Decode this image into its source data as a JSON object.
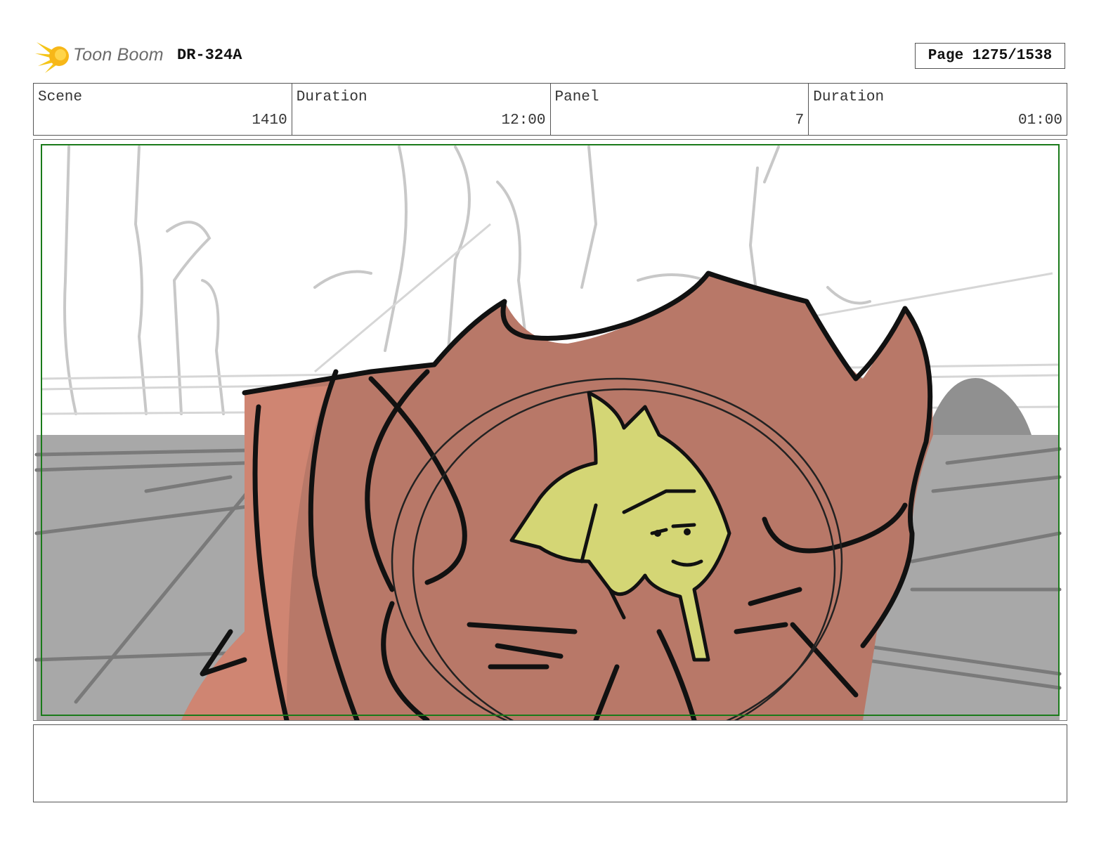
{
  "header": {
    "logo_text": "Toon Boom",
    "project_id": "DR-324A",
    "page_label": "Page 1275/1538"
  },
  "info": {
    "scene_label": "Scene",
    "scene_value": "1410",
    "scene_duration_label": "Duration",
    "scene_duration_value": "12:00",
    "panel_label": "Panel",
    "panel_value": "7",
    "panel_duration_label": "Duration",
    "panel_duration_value": "01:00"
  },
  "colors": {
    "logo_yellow": "#f5c518",
    "safe_area_green": "#1a7a1a",
    "creature_red": "#b87868",
    "bug_yellow": "#d4d675",
    "ground_gray": "#a8a8a8"
  },
  "notes": {
    "text": ""
  }
}
